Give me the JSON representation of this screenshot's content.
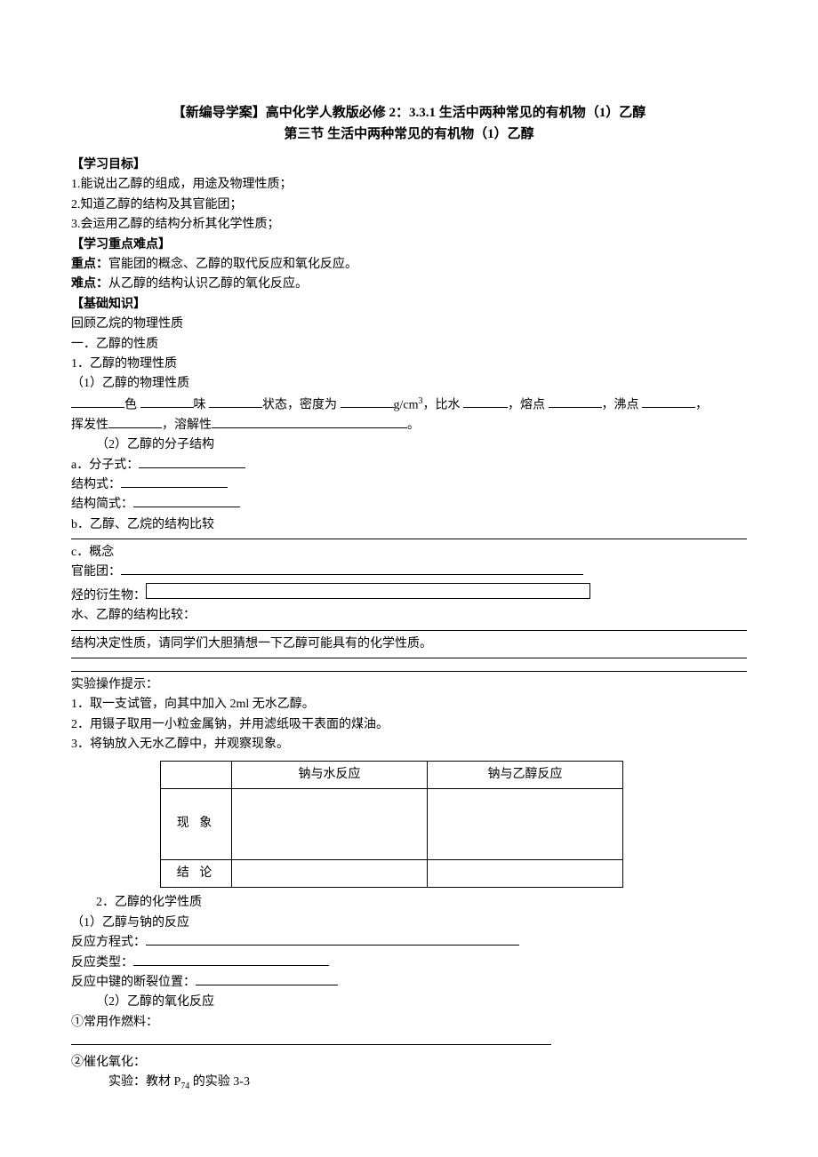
{
  "title": {
    "line1": "【新编导学案】高中化学人教版必修 2：3.3.1 生活中两种常见的有机物（1）乙醇",
    "line2": "第三节  生活中两种常见的有机物（1）乙醇"
  },
  "objectives": {
    "head": "【学习目标】",
    "items": [
      "1.能说出乙醇的组成，用途及物理性质；",
      "2.知道乙醇的结构及其官能团；",
      "3.会运用乙醇的结构分析其化学性质；"
    ]
  },
  "focus": {
    "head": "【学习重点难点】",
    "key_label": "重点：",
    "key_text": "官能团的概念、乙醇的取代反应和氧化反应。",
    "diff_label": "难点：",
    "diff_text": "从乙醇的结构认识乙醇的氧化反应。"
  },
  "basics": {
    "head": "【基础知识】",
    "review": "回顾乙烷的物理性质",
    "sec1": "一．乙醇的性质",
    "sec1_1": "1．乙醇的物理性质",
    "sec1_1_1": "（1）乙醇的物理性质",
    "phys": {
      "color": "色",
      "taste": "味",
      "state": "状态，密度为",
      "unit": "g/cm",
      "sup": "3",
      "cmp_water": "，比水",
      "mp": "，熔点",
      "bp": "，沸点",
      "comma": "，",
      "volatile": "挥发性",
      "sol": "，溶解性",
      "period": "。"
    },
    "sec1_1_2": "（2）乙醇的分子结构",
    "a_label": "a．分子式：",
    "struct_formula": "结构式：",
    "struct_simple": "结构简式：",
    "b_label": "b．乙醇、乙烷的结构比较",
    "c_label": "c．概念",
    "func_group": "官能团：",
    "derivative": "烃的衍生物：",
    "water_cmp": "水、乙醇的结构比较：",
    "guess": "结构决定性质，请同学们大胆猜想一下乙醇可能具有的化学性质。"
  },
  "experiment": {
    "tips_head": "实验操作提示：",
    "steps": [
      "1．取一支试管，向其中加入 2ml 无水乙醇。",
      "2．用镊子取用一小粒金属钠，并用滤纸吸干表面的煤油。",
      "3．将钠放入无水乙醇中，并观察现象。"
    ],
    "table": {
      "h1": "钠与水反应",
      "h2": "钠与乙醇反应",
      "row1": "现 象",
      "row2": "结 论"
    }
  },
  "chem": {
    "sec2": "2．乙醇的化学性质",
    "r1": "（1）乙醇与钠的反应",
    "eq": "反应方程式：",
    "type": "反应类型：",
    "break_pos": "反应中键的断裂位置：",
    "r2": "（2）乙醇的氧化反应",
    "fuel": "①常用作燃料：",
    "cat": "②催化氧化：",
    "exp_ref_prefix": "实验：教材 P",
    "exp_ref_sub": "74",
    "exp_ref_suffix": " 的实验 3-3"
  }
}
